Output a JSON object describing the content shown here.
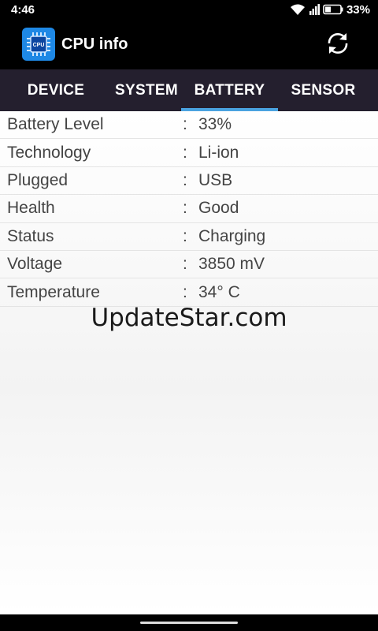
{
  "status_bar": {
    "time": "4:46",
    "battery_percent": "33%",
    "icons": [
      "wifi-icon",
      "signal-icon",
      "battery-icon"
    ]
  },
  "app_bar": {
    "title": "CPU info",
    "icon_text": "CPU",
    "icons": [
      "cpu-chip-icon",
      "refresh-icon"
    ]
  },
  "tabs": [
    {
      "label": "DEVICE",
      "active": false
    },
    {
      "label": "SYSTEM",
      "active": false
    },
    {
      "label": "BATTERY",
      "active": true
    },
    {
      "label": "SENSOR",
      "active": false
    }
  ],
  "battery_info": [
    {
      "label": "Battery Level",
      "separator": ":",
      "value": "33%"
    },
    {
      "label": "Technology",
      "separator": ":",
      "value": "Li-ion"
    },
    {
      "label": "Plugged",
      "separator": ":",
      "value": "USB"
    },
    {
      "label": "Health",
      "separator": ":",
      "value": "Good"
    },
    {
      "label": "Status",
      "separator": ":",
      "value": "Charging"
    },
    {
      "label": "Voltage",
      "separator": ":",
      "value": "3850 mV"
    },
    {
      "label": "Temperature",
      "separator": ":",
      "value": "34° C"
    }
  ],
  "watermark": "UpdateStar.com",
  "colors": {
    "app_bar_bg": "#000000",
    "tab_bar_bg": "#241f2e",
    "tab_indicator": "#4aa3e0",
    "app_icon_bg": "#1e88e5"
  }
}
